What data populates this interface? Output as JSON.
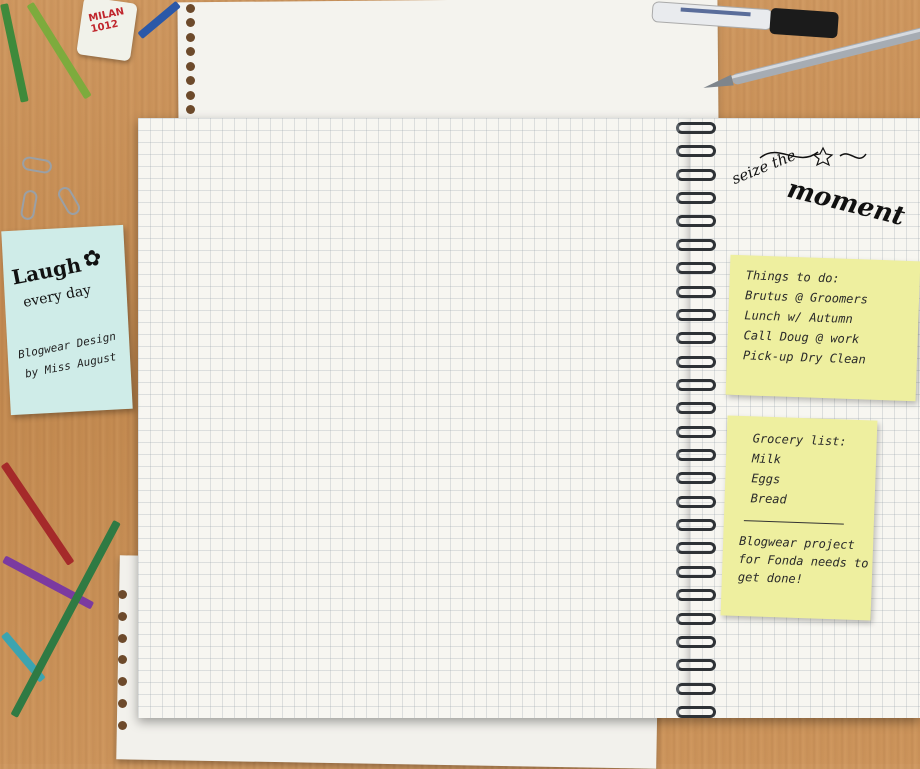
{
  "colors": {
    "desk": "#c98e55",
    "paper": "#f7f6f1",
    "sticky_blue": "#cfece8",
    "sticky_yellow": "#eeef9f",
    "spiral": "#2e3236"
  },
  "laugh_note": {
    "title": "Laugh",
    "subtitle": "every day",
    "credit_line1": "Blogwear Design",
    "credit_line2": "by Miss August"
  },
  "eraser": {
    "label": "MILAN 1012"
  },
  "seize": {
    "top": "seize the",
    "main": "moment"
  },
  "todo_note": {
    "title": "Things to do:",
    "items": [
      "Brutus @ Groomers",
      "Lunch w/ Autumn",
      "Call Doug @ work",
      "Pick-up Dry Clean"
    ]
  },
  "grocery_note": {
    "title": "Grocery list:",
    "items": [
      "Milk",
      "Eggs",
      "Bread"
    ],
    "project_line1": "Blogwear project",
    "project_line2": "for Fonda needs to",
    "project_line3": "get done!"
  }
}
